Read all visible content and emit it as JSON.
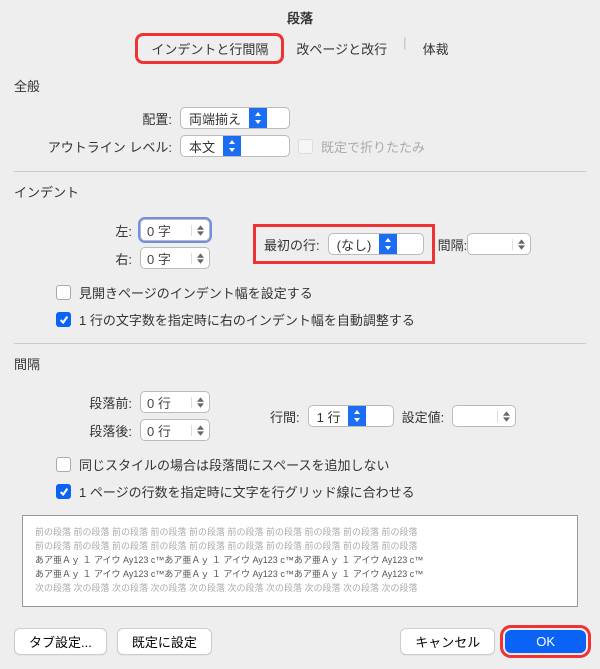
{
  "title": "段落",
  "tabs": {
    "t1": "インデントと行間隔",
    "t2": "改ページと改行",
    "t3": "体裁"
  },
  "general": {
    "title": "全般",
    "alignment_label": "配置:",
    "alignment_value": "両端揃え",
    "outline_label": "アウトライン レベル:",
    "outline_value": "本文",
    "collapse_label": "既定で折りたたみ"
  },
  "indent": {
    "title": "インデント",
    "left_label": "左:",
    "left_value": "0 字",
    "right_label": "右:",
    "right_value": "0 字",
    "first_label": "最初の行:",
    "first_value": "(なし)",
    "by_label": "間隔:",
    "by_value": "",
    "mirror_label": "見開きページのインデント幅を設定する",
    "auto_label": "1 行の文字数を指定時に右のインデント幅を自動調整する"
  },
  "spacing": {
    "title": "間隔",
    "before_label": "段落前:",
    "before_value": "0 行",
    "after_label": "段落後:",
    "after_value": "0 行",
    "line_label": "行間:",
    "line_value": "1 行",
    "set_label": "設定値:",
    "set_value": "",
    "nospace_label": "同じスタイルの場合は段落間にスペースを追加しない",
    "grid_label": "1 ページの行数を指定時に文字を行グリッド線に合わせる"
  },
  "preview": {
    "l1": "前の段落 前の段落 前の段落 前の段落 前の段落 前の段落 前の段落 前の段落 前の段落 前の段落",
    "l2": "前の段落 前の段落 前の段落 前の段落 前の段落 前の段落 前の段落 前の段落 前の段落 前の段落",
    "l3": "あア亜Ａｙ １ アイウ Ay123 c™あア亜Ａｙ １ アイウ Ay123 c™あア亜Ａｙ １ アイウ Ay123 c™",
    "l4": "あア亜Ａｙ １ アイウ Ay123 c™あア亜Ａｙ １ アイウ Ay123 c™あア亜Ａｙ １ アイウ Ay123 c™",
    "l5": "次の段落 次の段落 次の段落 次の段落 次の段落 次の段落 次の段落 次の段落 次の段落 次の段落"
  },
  "buttons": {
    "tabs": "タブ設定...",
    "default": "既定に設定",
    "cancel": "キャンセル",
    "ok": "OK"
  }
}
